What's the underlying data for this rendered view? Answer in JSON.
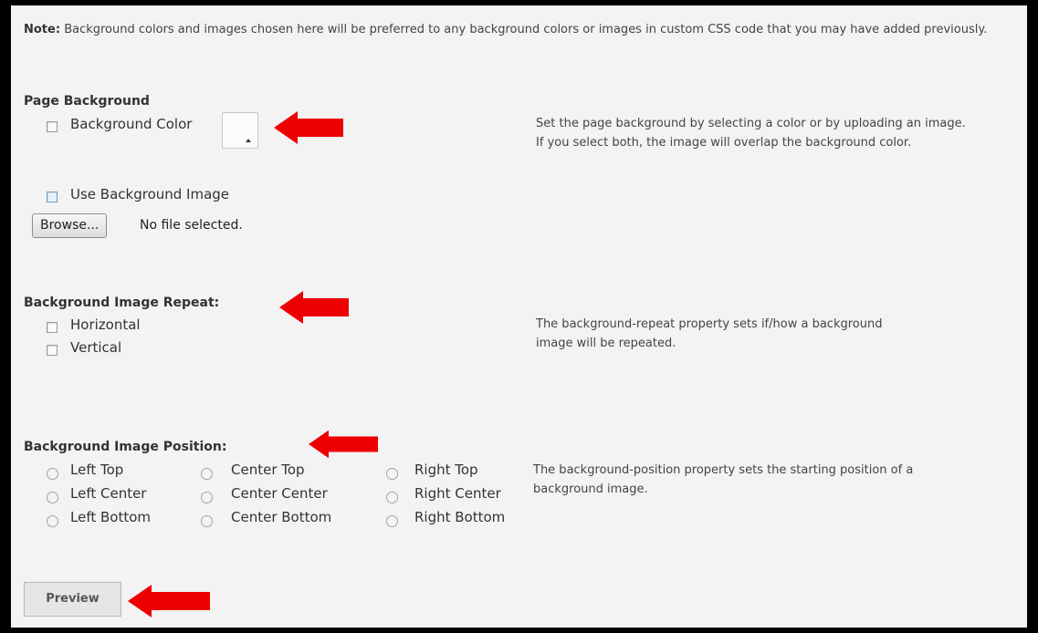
{
  "note": {
    "prefix": "Note:",
    "text": "Background colors and images chosen here will be preferred to any background colors or images in custom CSS code that you may have added previously."
  },
  "page_background": {
    "heading": "Page Background",
    "bg_color_label": "Background Color",
    "description": "Set the page background by selecting a color or by uploading an image. If you select both, the image will overlap the background color.",
    "use_image_label": "Use Background Image",
    "browse_label": "Browse...",
    "file_status": "No file selected."
  },
  "repeat": {
    "heading": "Background Image Repeat:",
    "options": [
      "Horizontal",
      "Vertical"
    ],
    "description": "The background-repeat property sets if/how a background image will be repeated."
  },
  "position": {
    "heading": "Background Image Position:",
    "options": [
      [
        "Left Top",
        "Center Top",
        "Right Top"
      ],
      [
        "Left Center",
        "Center Center",
        "Right Center"
      ],
      [
        "Left Bottom",
        "Center Bottom",
        "Right Bottom"
      ]
    ],
    "description": "The background-position property sets the starting position of a background image."
  },
  "preview_label": "Preview",
  "colors": {
    "annotation_arrow": "#ee0000",
    "frame": "#000000",
    "panel_background": "#f3f3f3"
  },
  "icons": [
    "red-arrow-icon",
    "color-picker-arrow-icon"
  ]
}
